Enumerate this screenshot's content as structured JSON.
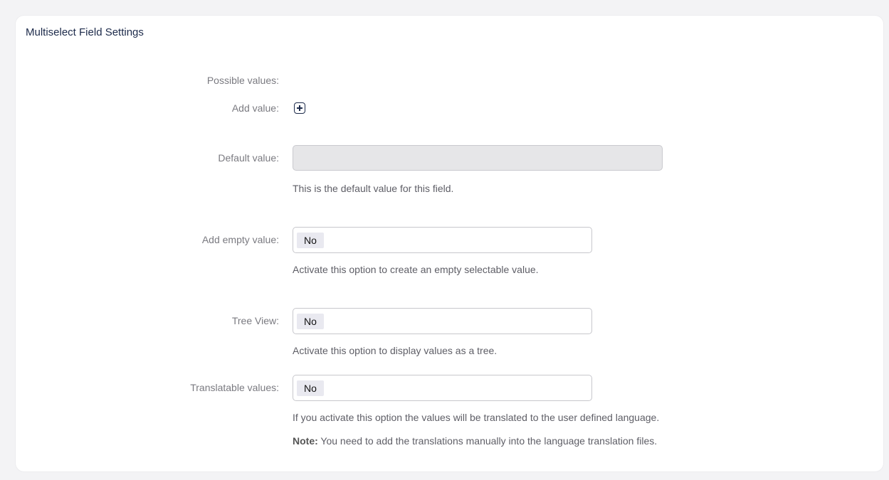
{
  "card": {
    "title": "Multiselect Field Settings"
  },
  "fields": {
    "possible_values": {
      "label": "Possible values:"
    },
    "add_value": {
      "label": "Add value:",
      "icon": "plus-square-icon"
    },
    "default_value": {
      "label": "Default value:",
      "value": "",
      "help": "This is the default value for this field."
    },
    "add_empty_value": {
      "label": "Add empty value:",
      "selected": "No",
      "help": "Activate this option to create an empty selectable value."
    },
    "tree_view": {
      "label": "Tree View:",
      "selected": "No",
      "help": "Activate this option to display values as a tree."
    },
    "translatable_values": {
      "label": "Translatable values:",
      "selected": "No",
      "help": "If you activate this option the values will be translated to the user defined language.",
      "note_label": "Note:",
      "note_text": " You need to add the translations manually into the language translation files."
    }
  }
}
